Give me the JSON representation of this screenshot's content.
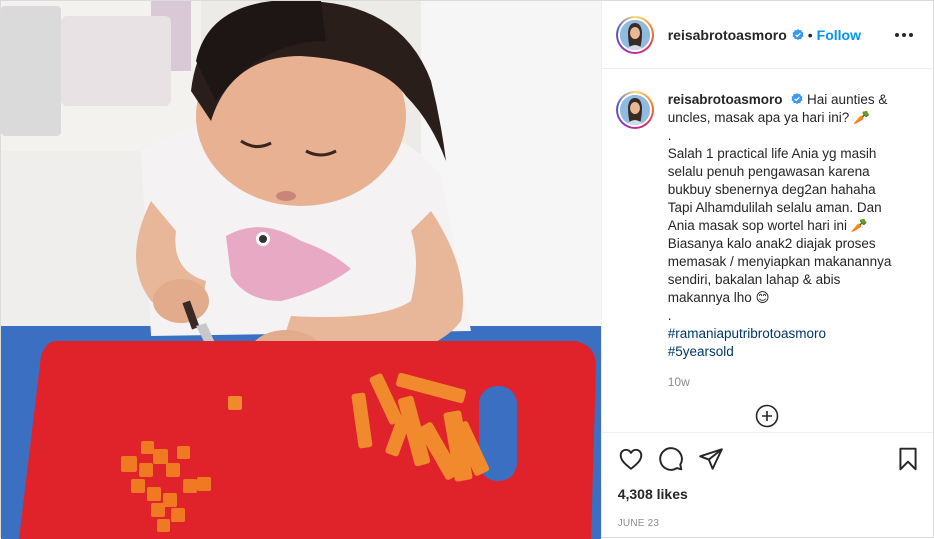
{
  "post": {
    "username": "reisabrotoasmoro",
    "dot": "•",
    "follow_label": "Follow",
    "caption_lines": [
      "Hai aunties &",
      "uncles, masak apa ya hari ini? 🥕",
      ".",
      "Salah 1 practical life Ania yg masih",
      "selalu penuh pengawasan karena",
      "bukbuy sbenernya deg2an hahaha",
      "Tapi Alhamdulilah selalu aman. Dan",
      "Ania masak sop wortel hari ini 🥕",
      "Biasanya kalo anak2 diajak proses",
      "memasak / menyiapkan makanannya",
      "sendiri, bakalan lahap & abis",
      "makannya lho 😊",
      "."
    ],
    "hashtags": [
      "#ramaniaputribrotoasmoro",
      "#5yearsold"
    ],
    "time_ago": "10w",
    "likes": "4,308 likes",
    "date": "JUNE 23"
  },
  "icons": {
    "verified": "verified-badge-icon",
    "more": "more-options-icon",
    "like": "heart-icon",
    "comment": "comment-icon",
    "share": "share-icon",
    "save": "bookmark-icon",
    "load_more": "plus-circle-icon"
  },
  "colors": {
    "link": "#0095f6",
    "hashtag": "#00376b",
    "muted": "#8e8e8e",
    "text": "#262626"
  }
}
